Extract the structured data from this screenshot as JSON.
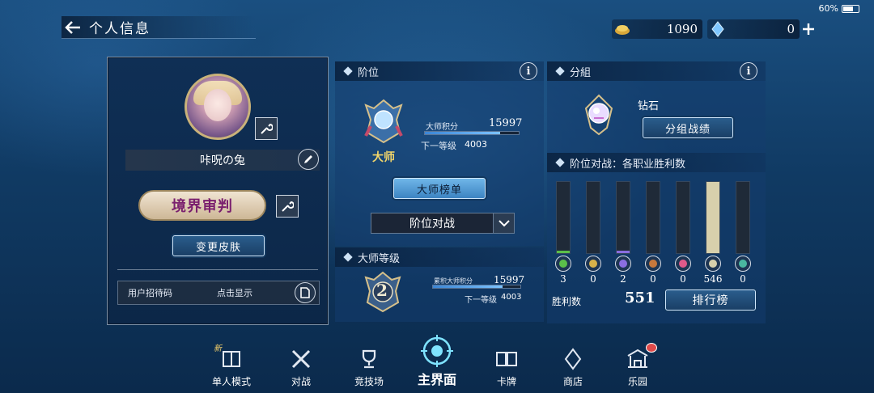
{
  "status": {
    "battery": "60%"
  },
  "header": {
    "title": "个人信息"
  },
  "currency": {
    "gold": "1090",
    "crystal": "0"
  },
  "profile": {
    "name": "咔呪の兔",
    "title_plate": "境界审判",
    "change_skin": "变更皮肤",
    "invite_label": "用户招待码",
    "invite_action": "点击显示"
  },
  "rank": {
    "section_title": "阶位",
    "rank_name": "大师",
    "points_label": "大师积分",
    "points": "15997",
    "next_label": "下一等级",
    "next_value": "4003",
    "progress": 0.8,
    "list_button": "大师榜单",
    "select_value": "阶位对战"
  },
  "master_level": {
    "section_title": "大师等级",
    "level": "2",
    "points_label": "累积大师积分",
    "points": "15997",
    "next_label": "下一等级",
    "next_value": "4003",
    "progress": 0.8
  },
  "group": {
    "section_title": "分組",
    "group_name": "钻石",
    "button": "分组战绩",
    "stats_title": "阶位对战：各职业胜利数",
    "classes": [
      {
        "icon": "leaf-icon",
        "value": "3",
        "fill": 0.02,
        "color": "#5bbf4a"
      },
      {
        "icon": "crown-icon",
        "value": "0",
        "fill": 0.0,
        "color": "#d8b24a"
      },
      {
        "icon": "sigil-icon",
        "value": "2",
        "fill": 0.015,
        "color": "#8a6ee0"
      },
      {
        "icon": "beast-icon",
        "value": "0",
        "fill": 0.0,
        "color": "#c7783c"
      },
      {
        "icon": "dragon-icon",
        "value": "0",
        "fill": 0.0,
        "color": "#e05a8a"
      },
      {
        "icon": "bishop-icon",
        "value": "546",
        "fill": 1.0,
        "color": "#d7d0ac"
      },
      {
        "icon": "portal-icon",
        "value": "0",
        "fill": 0.0,
        "color": "#4ab8a0"
      }
    ],
    "wins_label": "胜利数",
    "wins_value": "551",
    "leaderboard_button": "排行榜"
  },
  "nav": {
    "new_badge": "新",
    "items": [
      {
        "label": "单人模式",
        "icon": "book-icon"
      },
      {
        "label": "对战",
        "icon": "crossed-swords-icon"
      },
      {
        "label": "竞技场",
        "icon": "trophy-icon"
      },
      {
        "label": "主界面",
        "icon": "home-emblem-icon"
      },
      {
        "label": "卡牌",
        "icon": "cards-icon"
      },
      {
        "label": "商店",
        "icon": "shop-crystal-icon"
      },
      {
        "label": "乐园",
        "icon": "park-gate-icon"
      }
    ]
  }
}
